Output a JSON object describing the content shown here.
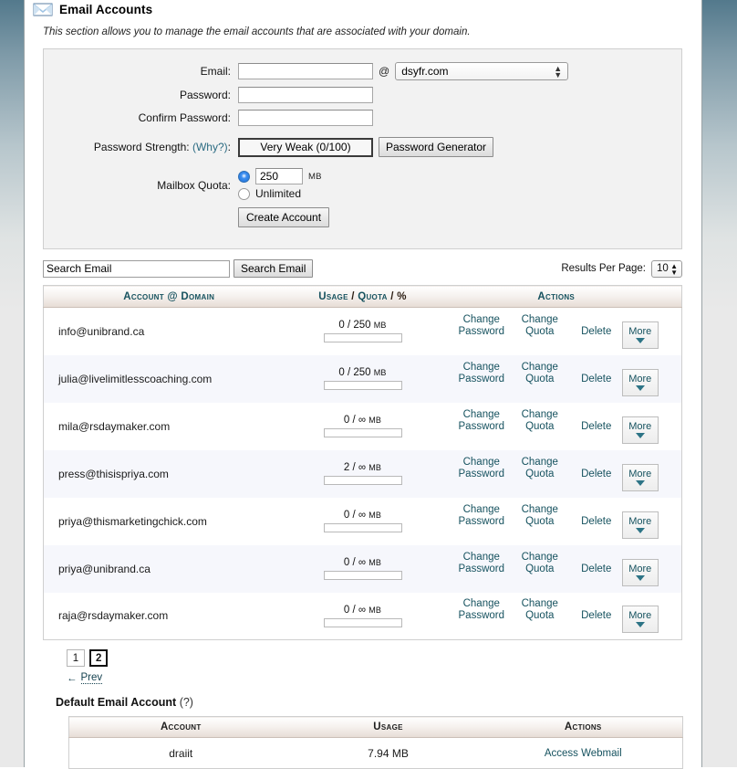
{
  "header": {
    "icon": "envelope-icon",
    "title": "Email Accounts",
    "description": "This section allows you to manage the email accounts that are associated with your domain."
  },
  "create_form": {
    "email_label": "Email:",
    "email_value": "",
    "at_symbol": "@",
    "domain_value": "dsyfr.com",
    "password_label": "Password:",
    "password_value": "",
    "confirm_label": "Confirm Password:",
    "confirm_value": "",
    "strength_label": "Password Strength:",
    "strength_why": "(Why?)",
    "strength_colon": ":",
    "strength_value": "Very Weak (0/100)",
    "generator_button": "Password Generator",
    "quota_label": "Mailbox Quota:",
    "quota_value": "250",
    "quota_unit": "MB",
    "quota_unlimited": "Unlimited",
    "create_button": "Create Account"
  },
  "search": {
    "input_value": "Search Email",
    "button_label": "Search Email",
    "results_per_page_label": "Results Per Page:",
    "results_per_page_value": "10"
  },
  "accounts_table": {
    "headers": {
      "account": "Account @ Domain",
      "usage_a": "Usage",
      "usage_sep1": "/",
      "usage_b": "Quota",
      "usage_sep2": "/",
      "usage_c": "%",
      "actions": "Actions"
    },
    "actions": {
      "change_password": "Change Password",
      "change_quota": "Change Quota",
      "delete": "Delete",
      "more": "More"
    },
    "rows": [
      {
        "account": "info@unibrand.ca",
        "used": "0",
        "quota": "250",
        "unit": "MB",
        "percent": 0
      },
      {
        "account": "julia@livelimitlesscoaching.com",
        "used": "0",
        "quota": "250",
        "unit": "MB",
        "percent": 0
      },
      {
        "account": "mila@rsdaymaker.com",
        "used": "0",
        "quota": "∞",
        "unit": "MB",
        "percent": 0
      },
      {
        "account": "press@thisispriya.com",
        "used": "2",
        "quota": "∞",
        "unit": "MB",
        "percent": 0
      },
      {
        "account": "priya@thismarketingchick.com",
        "used": "0",
        "quota": "∞",
        "unit": "MB",
        "percent": 0
      },
      {
        "account": "priya@unibrand.ca",
        "used": "0",
        "quota": "∞",
        "unit": "MB",
        "percent": 0
      },
      {
        "account": "raja@rsdaymaker.com",
        "used": "0",
        "quota": "∞",
        "unit": "MB",
        "percent": 0
      }
    ]
  },
  "pagination": {
    "pages": [
      "1",
      "2"
    ],
    "current": "2",
    "prev_arrow": "←",
    "prev_label": "Prev"
  },
  "default_account": {
    "title": "Default Email Account",
    "help": "(?)",
    "headers": {
      "account": "Account",
      "usage": "Usage",
      "actions": "Actions"
    },
    "row": {
      "account": "draiit",
      "usage": "7.94 MB",
      "action": "Access Webmail"
    }
  },
  "colors": {
    "link": "#16525f",
    "header_text": "#16525f",
    "row_alt": "#f6f7fc",
    "panel_bg": "#f2f2f2",
    "gutter_top": "#53798c"
  }
}
